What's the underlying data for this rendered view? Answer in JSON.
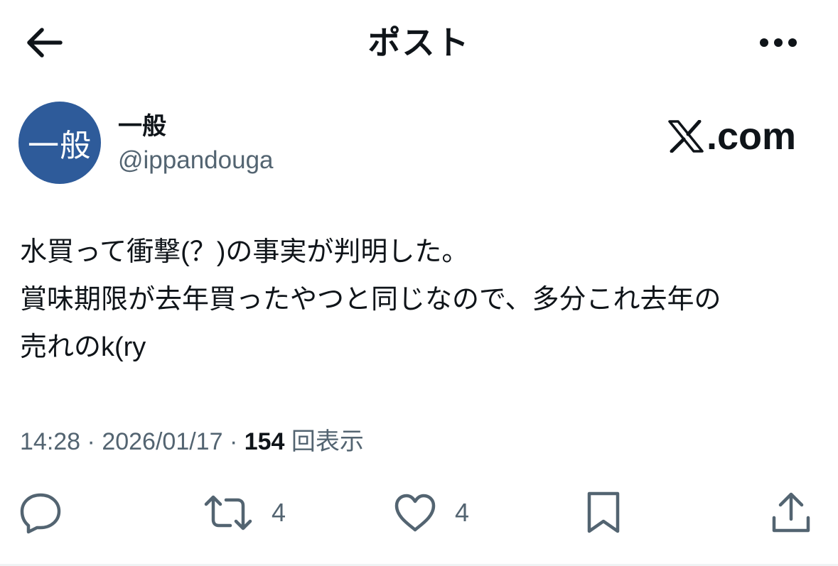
{
  "header": {
    "back_icon": "arrow-left-icon",
    "title": "ポスト",
    "more_icon": "more-horizontal-icon"
  },
  "author": {
    "avatar_text": "一般",
    "avatar_color": "#2e5b9a",
    "display_name": "一般",
    "handle": "@ippandouga"
  },
  "watermark": {
    "text": ".com",
    "icon": "x-logo-icon"
  },
  "tweet": {
    "lines": [
      "水買って衝撃(？)の事実が判明した。",
      "賞味期限が去年買ったやつと同じなので、多分これ去年の",
      "売れのk(ry"
    ]
  },
  "meta": {
    "time": "14:28",
    "separator": "·",
    "date": "2026/01/17",
    "views_count": "154",
    "views_label": "回表示"
  },
  "actions": {
    "reply": {
      "icon": "reply-icon",
      "count": ""
    },
    "retweet": {
      "icon": "retweet-icon",
      "count": "4"
    },
    "like": {
      "icon": "heart-icon",
      "count": "4"
    },
    "bookmark": {
      "icon": "bookmark-icon",
      "count": ""
    },
    "share": {
      "icon": "share-icon",
      "count": ""
    }
  },
  "colors": {
    "text_primary": "#0f1419",
    "text_secondary": "#536471",
    "divider": "#eff3f4"
  }
}
